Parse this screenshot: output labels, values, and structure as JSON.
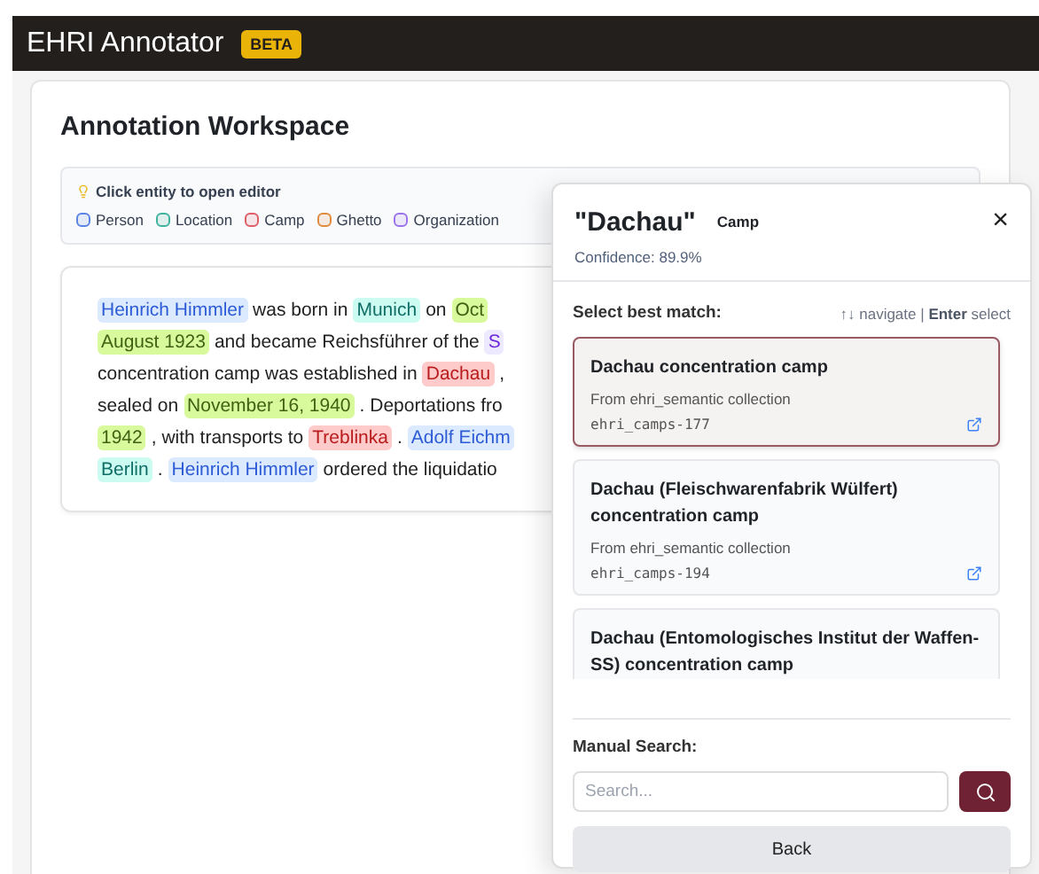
{
  "app": {
    "title": "EHRI Annotator",
    "badge": "BETA"
  },
  "workspace": {
    "title": "Annotation Workspace",
    "hint": "Click entity to open editor",
    "legend": [
      {
        "label": "Person",
        "color": "#5b84e6"
      },
      {
        "label": "Location",
        "color": "#3fb39d"
      },
      {
        "label": "Camp",
        "color": "#e05c66"
      },
      {
        "label": "Ghetto",
        "color": "#e08a3c"
      },
      {
        "label": "Organization",
        "color": "#9b74ec"
      }
    ]
  },
  "text_lines": [
    [
      {
        "text": "Heinrich Himmler",
        "kind": "person"
      },
      {
        "text": "was born in",
        "kind": "plain"
      },
      {
        "text": "Munich",
        "kind": "location"
      },
      {
        "text": "on",
        "kind": "plain"
      },
      {
        "text": "Oct",
        "kind": "date"
      }
    ],
    [
      {
        "text": "August 1923",
        "kind": "date"
      },
      {
        "text": "and became Reichsführer of the",
        "kind": "plain"
      },
      {
        "text": "S",
        "kind": "organization"
      }
    ],
    [
      {
        "text": "concentration camp was established in",
        "kind": "plain"
      },
      {
        "text": "Dachau",
        "kind": "camp"
      },
      {
        "text": ",",
        "kind": "plain"
      }
    ],
    [
      {
        "text": "sealed on",
        "kind": "plain"
      },
      {
        "text": "November 16, 1940",
        "kind": "date"
      },
      {
        "text": ". Deportations fro",
        "kind": "plain"
      }
    ],
    [
      {
        "text": "1942",
        "kind": "date"
      },
      {
        "text": ", with transports to",
        "kind": "plain"
      },
      {
        "text": "Treblinka",
        "kind": "camp"
      },
      {
        "text": ".",
        "kind": "plain"
      },
      {
        "text": "Adolf Eichm",
        "kind": "person"
      }
    ],
    [
      {
        "text": "Berlin",
        "kind": "location"
      },
      {
        "text": ".",
        "kind": "plain"
      },
      {
        "text": "Heinrich Himmler",
        "kind": "person"
      },
      {
        "text": "ordered the liquidatio",
        "kind": "plain"
      }
    ]
  ],
  "panel": {
    "title": "\"Dachau\"",
    "type": "Camp",
    "close": "×",
    "confidence": "Confidence: 89.9%",
    "list_label": "Select best match:",
    "hint": "↑↓ navigate | **Enter** select",
    "matches": [
      {
        "title": "Dachau concentration camp",
        "source": "From ehri_semantic collection",
        "id": "ehri_camps-177",
        "selected": true
      },
      {
        "title": "Dachau (Fleischwarenfabrik Wülfert) concentration camp",
        "source": "From ehri_semantic collection",
        "id": "ehri_camps-194",
        "selected": false
      },
      {
        "title": "Dachau (Entomologisches Institut der Waffen-SS) concentration camp",
        "selected": false
      }
    ],
    "manual_label": "Manual Search:",
    "placeholder": "Search...",
    "back": "Back"
  }
}
